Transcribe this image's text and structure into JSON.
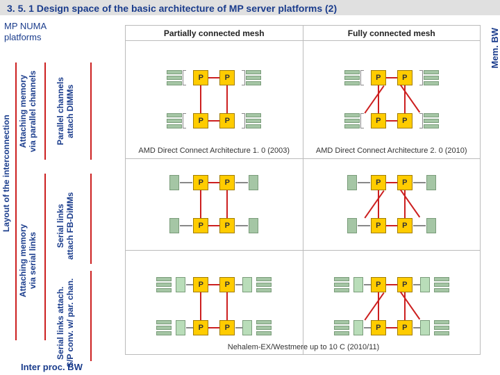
{
  "header": "3. 5. 1 Design space of the basic architecture of MP server platforms (2)",
  "platform_label": "MP NUMA\nplatforms",
  "side": {
    "layout": "Layout of the interconnection",
    "attach_par": "Attaching memory\nvia parallel channels",
    "par_ch": "Parallel channels\nattach DIMMs",
    "attach_ser": "Attaching memory\nvia serial links",
    "ser_fb": "Serial links\nattach FB-DiMMs",
    "ser_sp": "Serial links attach.\nS/P conv. w/ par. chan."
  },
  "cols": {
    "partial": "Partially connected mesh",
    "full": "Fully connected mesh"
  },
  "captions": {
    "amd10": "AMD Direct Connect Architecture 1. 0 (2003)",
    "amd20": "AMD Direct Connect Architecture 2. 0 (2010)",
    "nehalem": "Nehalem-EX/Westmere up to 10 C (2010/11)"
  },
  "labels": {
    "mem_bw": "Mem. BW",
    "inter_bw": "Inter proc. BW",
    "p": "P"
  }
}
